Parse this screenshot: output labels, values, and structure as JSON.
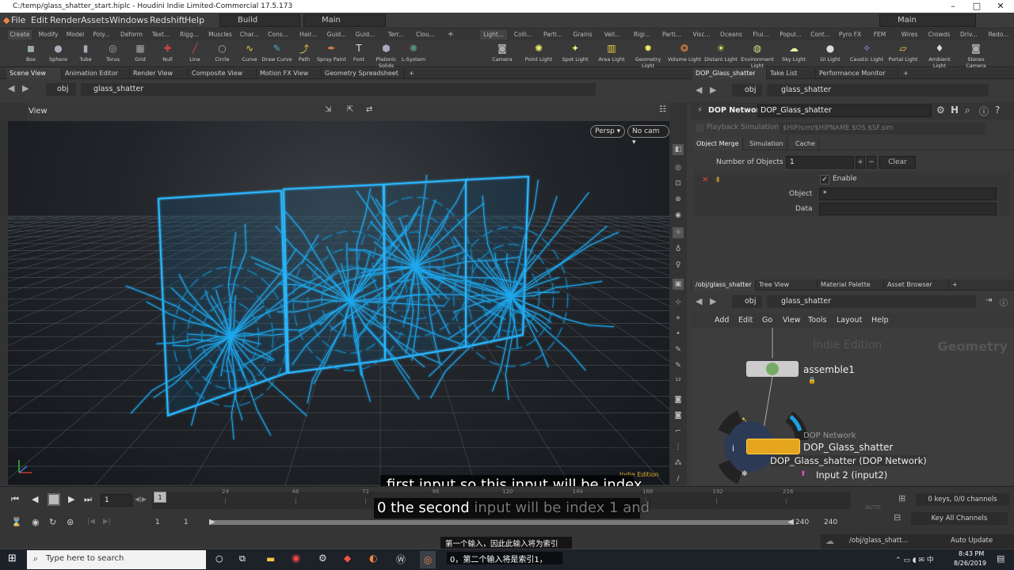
{
  "window": {
    "title": "C:/temp/glass_shatter_start.hiplc - Houdini Indie Limited-Commercial 17.5.173",
    "minimize": "–",
    "maximize": "□",
    "close": "✕"
  },
  "menu": {
    "items": [
      "File",
      "Edit",
      "Render",
      "Assets",
      "Windows",
      "Redshift",
      "Help"
    ],
    "desktop": "Build",
    "workspace": "Main",
    "right_workspace": "Main"
  },
  "shelf_tabs_left": [
    "Create",
    "Modify",
    "Model",
    "Poly...",
    "Deform",
    "Text...",
    "Rigg...",
    "Muscles",
    "Char...",
    "Cons...",
    "Hair...",
    "Guid...",
    "Guid...",
    "Terr...",
    "Clou..."
  ],
  "shelf_tabs_right": [
    "Light...",
    "Colli...",
    "Parti...",
    "Grains",
    "Vell...",
    "Rigi...",
    "Parti...",
    "Visc...",
    "Oceans",
    "Flui...",
    "Popul...",
    "Cont...",
    "Pyro FX",
    "FEM",
    "Wires",
    "Crowds",
    "Driv...",
    "Redo..."
  ],
  "tools_left": [
    {
      "label": "Box",
      "icon": "◼",
      "color": "#9aa"
    },
    {
      "label": "Sphere",
      "icon": "●",
      "color": "#aab"
    },
    {
      "label": "Tube",
      "icon": "▮",
      "color": "#aab"
    },
    {
      "label": "Torus",
      "icon": "◎",
      "color": "#aab"
    },
    {
      "label": "Grid",
      "icon": "▦",
      "color": "#aaa"
    },
    {
      "label": "Null",
      "icon": "✚",
      "color": "#c44"
    },
    {
      "label": "Line",
      "icon": "╱",
      "color": "#c44"
    },
    {
      "label": "Circle",
      "icon": "○",
      "color": "#aaa"
    },
    {
      "label": "Curve",
      "icon": "∿",
      "color": "#ec4"
    },
    {
      "label": "Draw Curve",
      "icon": "✎",
      "color": "#4ac"
    },
    {
      "label": "Path",
      "icon": "⤴",
      "color": "#ec4"
    },
    {
      "label": "Spray Paint",
      "icon": "✒",
      "color": "#e84"
    },
    {
      "label": "Font",
      "icon": "T",
      "color": "#ddd"
    },
    {
      "label": "Platonic Solids",
      "icon": "⬢",
      "color": "#aab"
    },
    {
      "label": "L-System",
      "icon": "❋",
      "color": "#6a8"
    }
  ],
  "tools_right": [
    {
      "label": "Camera",
      "icon": "◙",
      "color": "#aaa"
    },
    {
      "label": "Point Light",
      "icon": "✺",
      "color": "#ee6"
    },
    {
      "label": "Spot Light",
      "icon": "✦",
      "color": "#ee6"
    },
    {
      "label": "Area Light",
      "icon": "▥",
      "color": "#ec4"
    },
    {
      "label": "Geometry Light",
      "icon": "✹",
      "color": "#ee6"
    },
    {
      "label": "Volume Light",
      "icon": "❂",
      "color": "#e84"
    },
    {
      "label": "Distant Light",
      "icon": "☀",
      "color": "#ee6"
    },
    {
      "label": "Environment Light",
      "icon": "◍",
      "color": "#dd8"
    },
    {
      "label": "Sky Light",
      "icon": "☁",
      "color": "#eea"
    },
    {
      "label": "GI Light",
      "icon": "●",
      "color": "#ddd"
    },
    {
      "label": "Caustic Light",
      "icon": "✧",
      "color": "#8ae"
    },
    {
      "label": "Portal Light",
      "icon": "▱",
      "color": "#ec4"
    },
    {
      "label": "Ambient Light",
      "icon": "♦",
      "color": "#ddd"
    },
    {
      "label": "Stereo Camera",
      "icon": "◙",
      "color": "#aaa"
    }
  ],
  "viewer_tabs": [
    "Scene View",
    "Animation Editor",
    "Render View",
    "Composite View",
    "Motion FX View",
    "Geometry Spreadsheet"
  ],
  "viewer": {
    "context": "obj",
    "node": "glass_shatter",
    "label": "View",
    "persp": "Persp ▾",
    "cam": "No cam ▾",
    "watermark": "Indie Edition"
  },
  "subtitle": {
    "line1": "first input so this input will be index",
    "line2_bold": "0 the second",
    "line2_faded": "input will be index 1 and",
    "chinese1": "第一个输入，因此此输入将为索引",
    "chinese2": "0，第二个输入将是索引1，"
  },
  "param_tabs": [
    "DOP_Glass_shatter",
    "Take List",
    "Performance Monitor"
  ],
  "param": {
    "context": "obj",
    "node": "glass_shatter",
    "type_label": "DOP Network",
    "name": "DOP_Glass_shatter",
    "playback": "Playback Simulation",
    "sim_path": "$HIP/sim/$HIPNAME.$OS.$SF.sim",
    "subtabs": [
      "Object Merge",
      "Simulation",
      "Cache"
    ],
    "num_objects_label": "Number of Objects",
    "num_objects": "1",
    "clear": "Clear",
    "plus": "+",
    "minus": "−",
    "enable": "Enable",
    "object_label": "Object",
    "object_value": "*",
    "data_label": "Data"
  },
  "net_tabs": [
    "/obj/glass_shatter",
    "Tree View",
    "Material Palette",
    "Asset Browser"
  ],
  "net": {
    "context": "obj",
    "node": "glass_shatter",
    "menu": [
      "Add",
      "Edit",
      "Go",
      "View",
      "Tools",
      "Layout",
      "Help"
    ],
    "watermark": "Indie Edition",
    "context_label": "Geometry",
    "node1": "assemble1",
    "node2_type": "DOP Network",
    "node2_name": "DOP_Glass_shatter",
    "tooltip": "DOP_Glass_shatter (DOP Network)",
    "input_hint": "Input 2 (input2)"
  },
  "timeline": {
    "frame": "1",
    "range_start": "1",
    "range_start2": "1",
    "range_end": "240",
    "range_end2": "240",
    "ticks": [
      "24",
      "48",
      "72",
      "96",
      "120",
      "144",
      "168",
      "192",
      "216"
    ],
    "keys": "0 keys, 0/0 channels",
    "key_all": "Key All Channels",
    "auto_update": "Auto Update",
    "path": "/obj/glass_shatt..."
  },
  "taskbar": {
    "search": "Type here to search",
    "time": "8:43 PM",
    "date": "8/26/2019"
  }
}
